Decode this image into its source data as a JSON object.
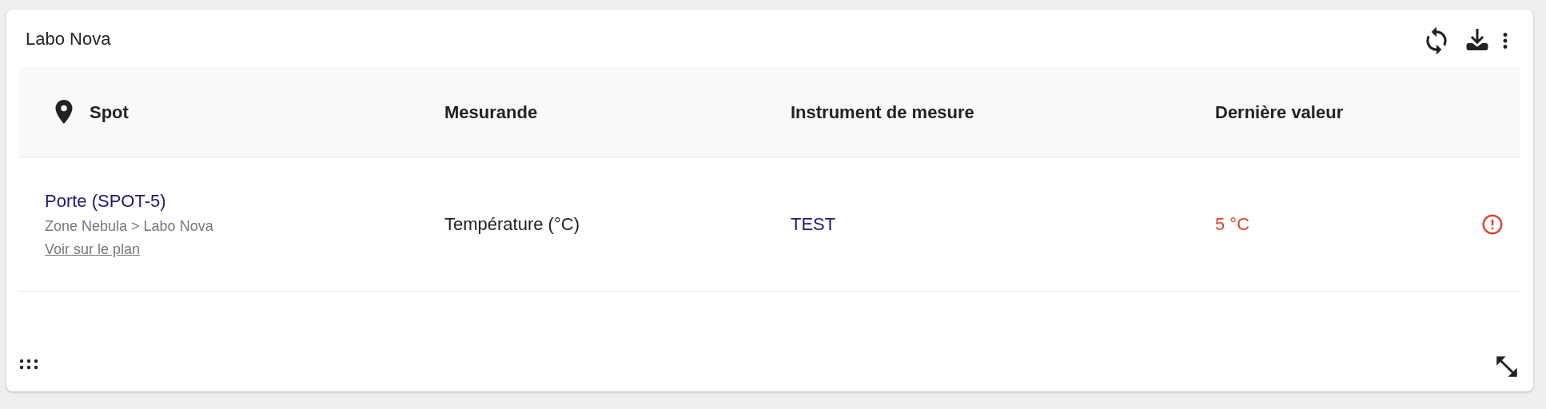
{
  "card": {
    "title": "Labo Nova"
  },
  "table": {
    "columns": [
      {
        "label": "Spot",
        "kind": "icon"
      },
      {
        "label": "Mesurande",
        "kind": "plain"
      },
      {
        "label": "Instrument de mesure",
        "kind": "plain"
      },
      {
        "label": "Dernière valeur",
        "kind": "plain"
      }
    ],
    "rows": [
      {
        "spot": {
          "name": "Porte (SPOT-5)",
          "path": "Zone Nebula > Labo Nova",
          "link": "Voir sur le plan"
        },
        "measurand": "Température (°C)",
        "instrument": "TEST",
        "value": "5 °C",
        "alert": true
      }
    ]
  }
}
